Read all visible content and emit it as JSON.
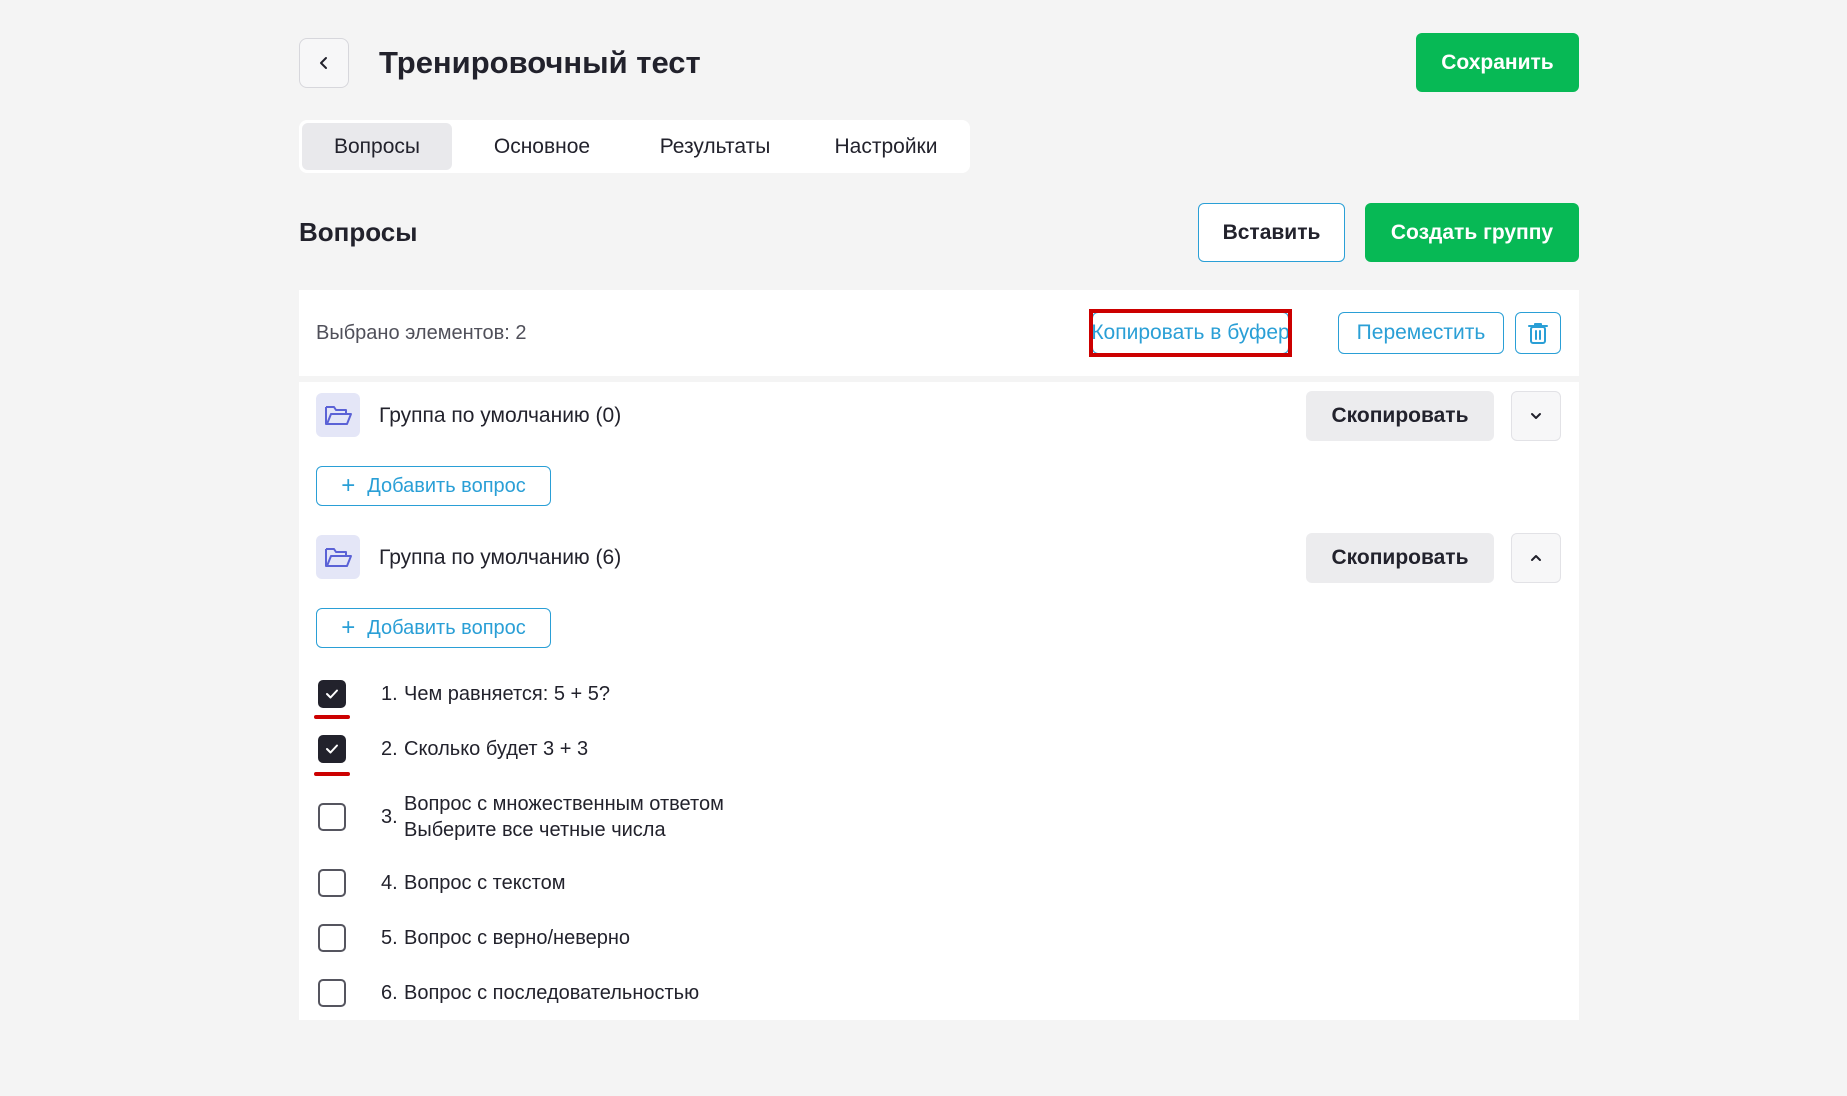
{
  "header": {
    "title": "Тренировочный тест",
    "save_label": "Сохранить"
  },
  "tabs": [
    {
      "label": "Вопросы",
      "active": true
    },
    {
      "label": "Основное",
      "active": false
    },
    {
      "label": "Результаты",
      "active": false
    },
    {
      "label": "Настройки",
      "active": false
    }
  ],
  "section": {
    "title": "Вопросы",
    "paste_label": "Вставить",
    "create_group_label": "Создать группу"
  },
  "selection": {
    "count_text": "Выбрано элементов: 2",
    "copy_to_clipboard_label": "Копировать в буфер",
    "move_label": "Переместить"
  },
  "groups": [
    {
      "name": "Группа по умолчанию (0)",
      "copy_label": "Скопировать",
      "add_question_label": "Добавить вопрос",
      "expanded": false,
      "toggle_icon": "chevron-down-icon"
    },
    {
      "name": "Группа по умолчанию (6)",
      "copy_label": "Скопировать",
      "add_question_label": "Добавить вопрос",
      "expanded": true,
      "toggle_icon": "chevron-up-icon"
    }
  ],
  "questions": [
    {
      "number": "1.",
      "lines": [
        "Чем равняется: 5 + 5?"
      ],
      "checked": true
    },
    {
      "number": "2.",
      "lines": [
        "Сколько будет 3 + 3"
      ],
      "checked": true
    },
    {
      "number": "3.",
      "lines": [
        "Вопрос с множественным ответом",
        "Выберите все четные числа"
      ],
      "checked": false
    },
    {
      "number": "4.",
      "lines": [
        "Вопрос с текстом"
      ],
      "checked": false
    },
    {
      "number": "5.",
      "lines": [
        "Вопрос с верно/неверно"
      ],
      "checked": false
    },
    {
      "number": "6.",
      "lines": [
        "Вопрос с последовательностью"
      ],
      "checked": false
    }
  ],
  "colors": {
    "accent_green": "#07b955",
    "link_blue": "#2a9fd6",
    "highlight_red": "#cc0000",
    "background": "#f4f4f4"
  }
}
